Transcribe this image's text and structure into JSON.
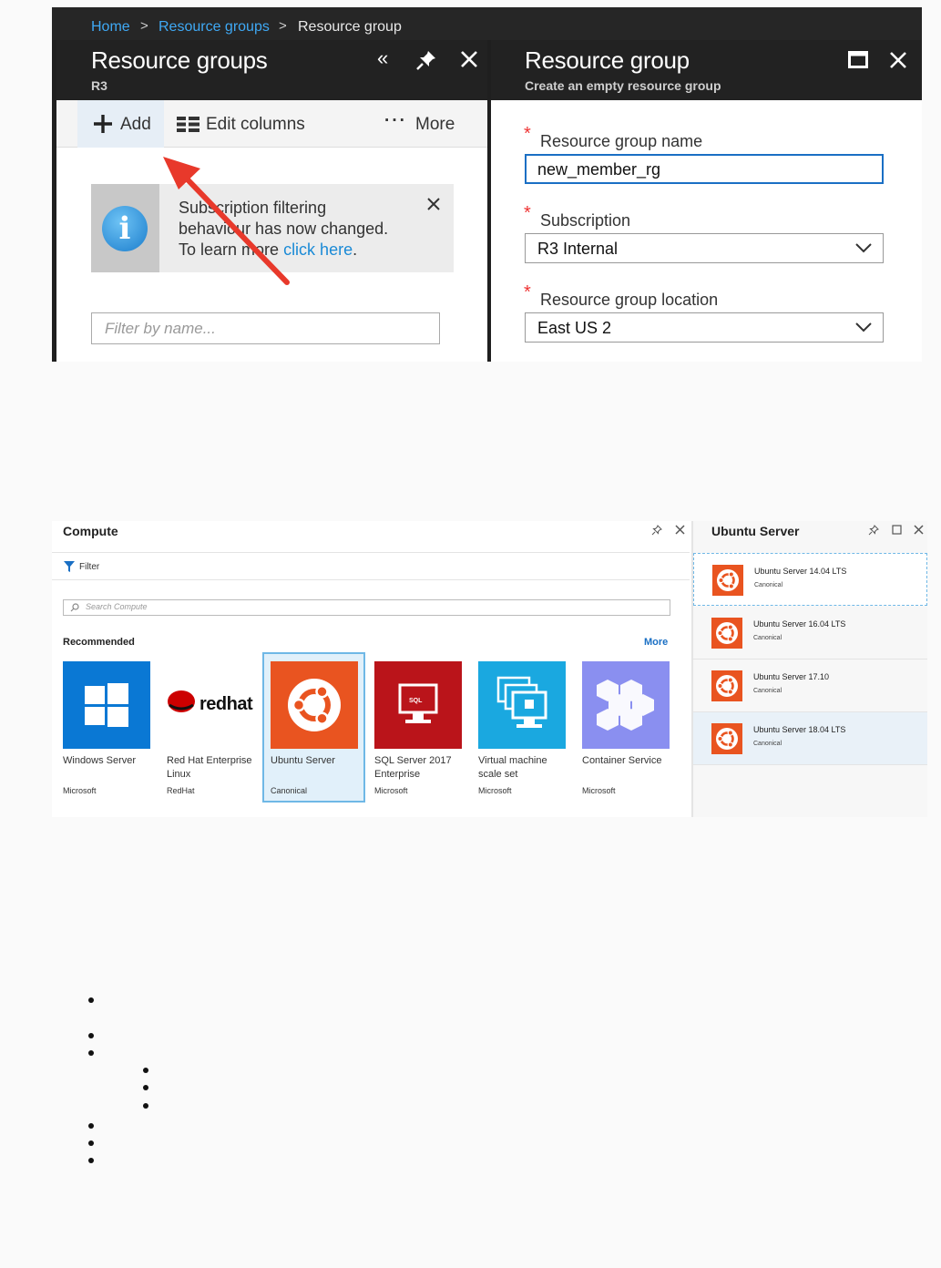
{
  "portal": {
    "breadcrumb": [
      "Home",
      "Resource groups",
      "Resource group"
    ],
    "left_blade": {
      "title": "Resource groups",
      "subtitle": "R3",
      "toolbar": {
        "add": "Add",
        "edit_columns": "Edit columns",
        "more": "More"
      },
      "info": {
        "line1": "Subscription filtering",
        "line2": "behaviour has now changed.",
        "line3_prefix": "To learn more ",
        "link": "click here",
        "line3_suffix": "."
      },
      "filter_placeholder": "Filter by name..."
    },
    "right_blade": {
      "title": "Resource group",
      "subtitle": "Create an empty resource group",
      "fields": {
        "name_label": "Resource group name",
        "name_value": "new_member_rg",
        "subscription_label": "Subscription",
        "subscription_value": "R3 Internal",
        "location_label": "Resource group location",
        "location_value": "East US 2"
      }
    },
    "annotation_color": "#e8392b"
  },
  "compute": {
    "title": "Compute",
    "filter_label": "Filter",
    "search_placeholder": "Search Compute",
    "recommended": "Recommended",
    "more": "More",
    "tiles": [
      {
        "name": "Windows Server",
        "publisher": "Microsoft",
        "color": "#0a78d4"
      },
      {
        "name": "Red Hat Enterprise Linux",
        "publisher": "RedHat",
        "logo_text": "redhat",
        "color": "#cc0000"
      },
      {
        "name": "Ubuntu Server",
        "publisher": "Canonical",
        "color": "#e95420",
        "selected": true
      },
      {
        "name": "SQL Server 2017 Enterprise",
        "publisher": "Microsoft",
        "color": "#ba141a",
        "badge": "SQL"
      },
      {
        "name": "Virtual machine scale set",
        "publisher": "Microsoft",
        "color": "#1aa8e0"
      },
      {
        "name": "Container Service",
        "publisher": "Microsoft",
        "color": "#8a8ff0"
      }
    ]
  },
  "ubuntu_panel": {
    "title": "Ubuntu Server",
    "items": [
      {
        "name": "Ubuntu Server 14.04 LTS",
        "publisher": "Canonical"
      },
      {
        "name": "Ubuntu Server 16.04 LTS",
        "publisher": "Canonical"
      },
      {
        "name": "Ubuntu Server 17.10",
        "publisher": "Canonical"
      },
      {
        "name": "Ubuntu Server 18.04 LTS",
        "publisher": "Canonical"
      }
    ]
  }
}
